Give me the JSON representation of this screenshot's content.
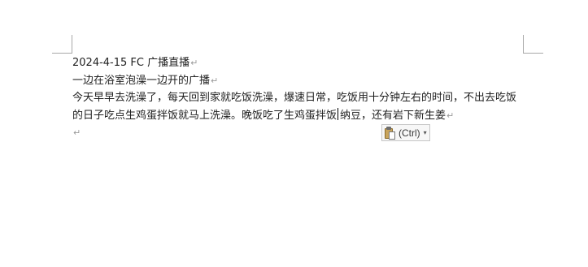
{
  "document": {
    "paragraphs": [
      "2024-4-15 FC 广播直播",
      "一边在浴室泡澡一边开的广播",
      "今天早早去洗澡了，每天回到家就吃饭洗澡，爆速日常，吃饭用十分钟左右的时间，不出去吃饭的日子吃点生鸡蛋拌饭就马上洗澡。晚饭吃了生鸡蛋拌饭",
      "纳豆，还有岩下新生姜",
      ""
    ],
    "paragraph_mark": "↵"
  },
  "paste_options": {
    "label": "(Ctrl)",
    "icon": "clipboard-paste-icon",
    "arrow": "▾"
  },
  "colors": {
    "text": "#1f1f1f",
    "paragraph_mark": "#9a9a9a",
    "margin_marks": "#a8a8a8"
  }
}
